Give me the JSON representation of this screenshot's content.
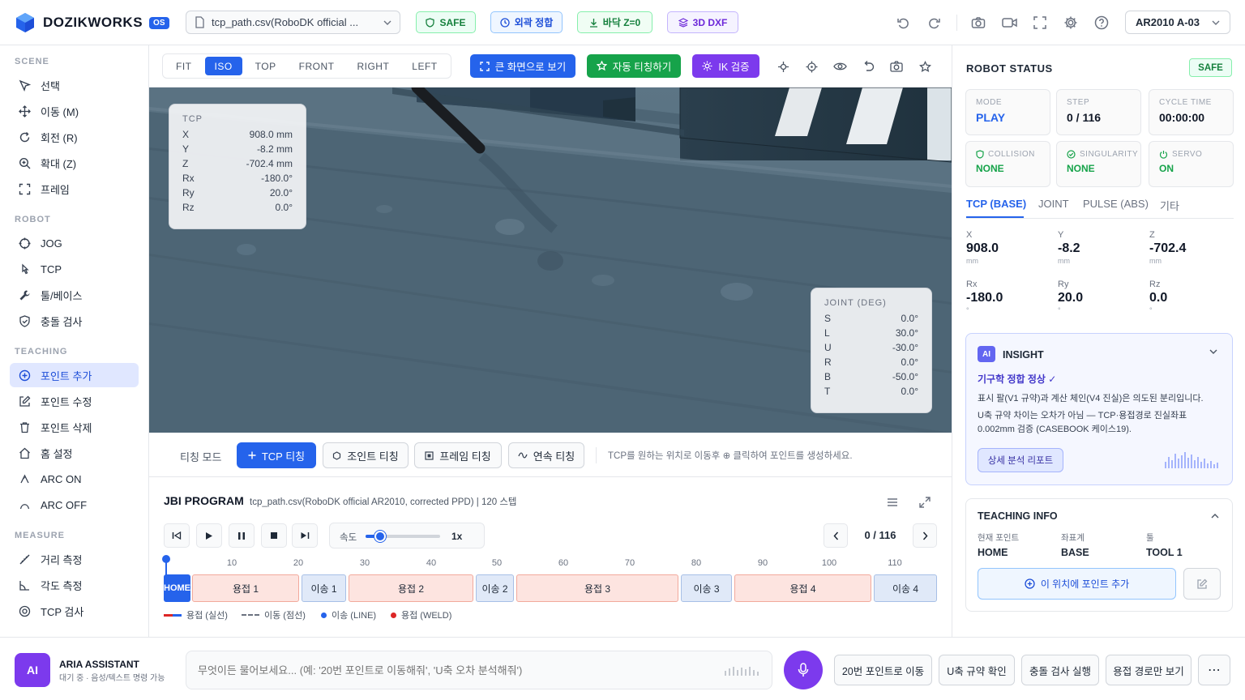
{
  "header": {
    "brand": "DOZIKWORKS",
    "brand_suffix": "OS",
    "file": "tcp_path.csv(RoboDK official ...",
    "badges": {
      "safe": "SAFE",
      "joint_match": "외곽 정합",
      "floor": "바닥 Z=0",
      "dxf": "3D DXF"
    },
    "robot": "AR2010 A-03"
  },
  "sidebar": {
    "scene_label": "SCENE",
    "scene": [
      "선택",
      "이동 (M)",
      "회전 (R)",
      "확대 (Z)",
      "프레임"
    ],
    "robot_label": "ROBOT",
    "robot": [
      "JOG",
      "TCP",
      "툴/베이스",
      "충돌 검사"
    ],
    "teaching_label": "TEACHING",
    "teaching": [
      "포인트 추가",
      "포인트 수정",
      "포인트 삭제",
      "홈 설정",
      "ARC ON",
      "ARC OFF"
    ],
    "measure_label": "MEASURE",
    "measure": [
      "거리 측정",
      "각도 측정",
      "TCP 검사"
    ]
  },
  "toolbar": {
    "views": [
      "FIT",
      "ISO",
      "TOP",
      "FRONT",
      "RIGHT",
      "LEFT"
    ],
    "fullscreen": "큰 화면으로 보기",
    "auto_teach": "자동 티칭하기",
    "ik": "IK 검증"
  },
  "tcp_overlay": {
    "title": "TCP",
    "rows": [
      {
        "k": "X",
        "v": "908.0 mm"
      },
      {
        "k": "Y",
        "v": "-8.2 mm"
      },
      {
        "k": "Z",
        "v": "-702.4 mm"
      },
      {
        "k": "Rx",
        "v": "-180.0°"
      },
      {
        "k": "Ry",
        "v": "20.0°"
      },
      {
        "k": "Rz",
        "v": "0.0°"
      }
    ]
  },
  "joint_overlay": {
    "title": "JOINT (DEG)",
    "rows": [
      {
        "k": "S",
        "v": "0.0°"
      },
      {
        "k": "L",
        "v": "30.0°"
      },
      {
        "k": "U",
        "v": "-30.0°"
      },
      {
        "k": "R",
        "v": "0.0°"
      },
      {
        "k": "B",
        "v": "-50.0°"
      },
      {
        "k": "T",
        "v": "0.0°"
      }
    ]
  },
  "teachbar": {
    "mode_label": "티칭 모드",
    "tcp": "TCP 티칭",
    "joint": "조인트 티칭",
    "frame": "프레임 티칭",
    "continuous": "연속 티칭",
    "hint": "TCP를 원하는 위치로 이동후 ⊕ 클릭하여 포인트를 생성하세요."
  },
  "program": {
    "title": "JBI PROGRAM",
    "subtitle": "tcp_path.csv(RoboDK official AR2010, corrected PPD) | 120 스텝",
    "speed_label": "속도",
    "speed_value": "1x",
    "speed_fraction": 0.2,
    "step": "0 / 116",
    "ticks": [
      "10",
      "20",
      "30",
      "40",
      "50",
      "60",
      "70",
      "80",
      "90",
      "100",
      "110"
    ],
    "segments": [
      {
        "label": "HOME",
        "type": "home"
      },
      {
        "label": "용접 1",
        "type": "weld"
      },
      {
        "label": "이송 1",
        "type": "move"
      },
      {
        "label": "용접 2",
        "type": "weld"
      },
      {
        "label": "이송 2",
        "type": "move"
      },
      {
        "label": "용접 3",
        "type": "weld"
      },
      {
        "label": "이송 3",
        "type": "move"
      },
      {
        "label": "용접 4",
        "type": "weld"
      },
      {
        "label": "이송 4",
        "type": "move"
      }
    ],
    "legend": [
      "용접 (실선)",
      "이동 (점선)",
      "이송 (LINE)",
      "용접 (WELD)"
    ]
  },
  "status": {
    "title": "ROBOT STATUS",
    "safe": "SAFE",
    "cards": [
      {
        "label": "MODE",
        "value": "PLAY"
      },
      {
        "label": "STEP",
        "value": "0 / 116"
      },
      {
        "label": "CYCLE TIME",
        "value": "00:00:00"
      },
      {
        "label": "COLLISION",
        "value": "NONE"
      },
      {
        "label": "SINGULARITY",
        "value": "NONE"
      },
      {
        "label": "SERVO",
        "value": "ON"
      }
    ],
    "tabs": [
      "TCP (BASE)",
      "JOINT",
      "PULSE (ABS)",
      "기타"
    ],
    "coords": [
      {
        "label": "X",
        "value": "908.0",
        "unit": "mm"
      },
      {
        "label": "Y",
        "value": "-8.2",
        "unit": "mm"
      },
      {
        "label": "Z",
        "value": "-702.4",
        "unit": "mm"
      },
      {
        "label": "Rx",
        "value": "-180.0",
        "unit": "°"
      },
      {
        "label": "Ry",
        "value": "20.0",
        "unit": "°"
      },
      {
        "label": "Rz",
        "value": "0.0",
        "unit": "°"
      }
    ]
  },
  "insight": {
    "badge": "AI",
    "title": "INSIGHT",
    "headline": "기구학 정합 정상 ✓",
    "p1": "표시 팔(V1 규약)과 계산 체인(V4 진실)은 의도된 분리입니다.",
    "p2": "U축 규약 차이는 오차가 아님 — TCP·용접경로 진실좌표 0.002mm 검증 (CASEBOOK 케이스19).",
    "report": "상세 분석 리포트"
  },
  "teaching_info": {
    "title": "TEACHING INFO",
    "cols": [
      {
        "label": "현재 포인트",
        "value": "HOME"
      },
      {
        "label": "좌표계",
        "value": "BASE"
      },
      {
        "label": "툴",
        "value": "TOOL 1"
      }
    ],
    "add": "이 위치에 포인트 추가"
  },
  "assistant": {
    "avatar": "AI",
    "name": "ARIA ASSISTANT",
    "status": "대기 중 · 음성/텍스트 명령 가능",
    "placeholder": "무엇이든 물어보세요... (예: '20번 포인트로 이동해줘', 'U축 오차 분석해줘')",
    "quick": [
      "20번 포인트로 이동",
      "U축 규약 확인",
      "충돌 검사 실행",
      "용접 경로만 보기"
    ],
    "more": "⋯"
  }
}
